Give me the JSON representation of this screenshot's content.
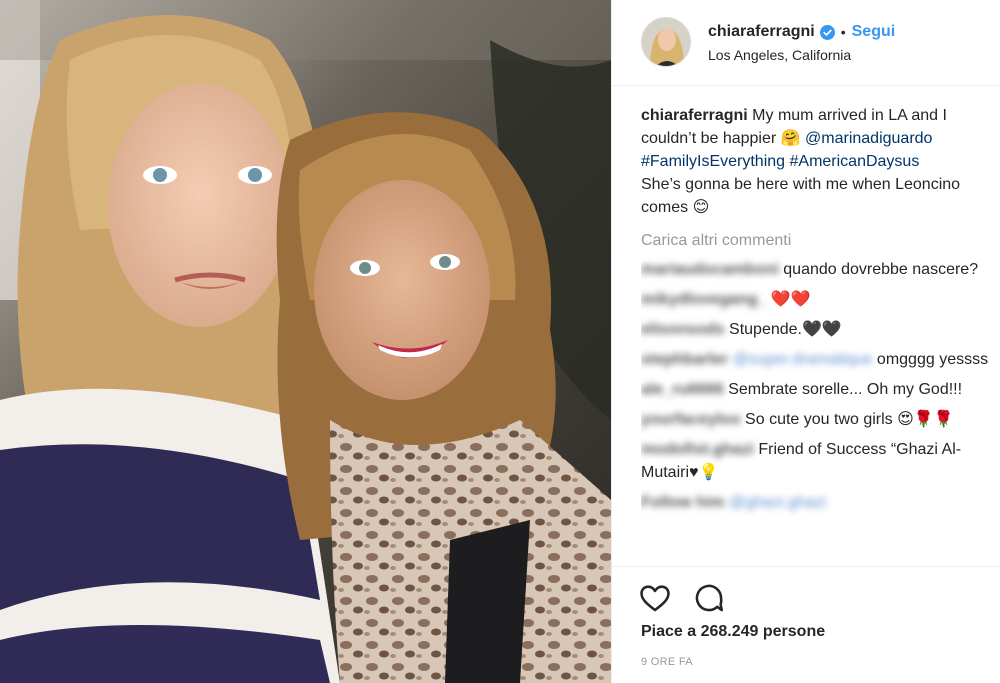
{
  "photo": {
    "alt": ""
  },
  "header": {
    "username": "chiaraferragni",
    "dot": "•",
    "follow_label": "Segui",
    "location": "Los Angeles, California"
  },
  "caption": {
    "username": "chiaraferragni",
    "text_1": "My mum arrived in LA and I couldn’t be happier 🤗",
    "mention": "@marinadiguardo",
    "hashtag_1": "#FamilyIsEverything",
    "hashtag_2": "#AmericanDaysus",
    "text_2": "She’s gonna be here with me when Leoncino comes 😊"
  },
  "load_more_label": "Carica altri commenti",
  "comments": [
    {
      "username": "mariaudocamboni",
      "text": "quando dovrebbe nascere?"
    },
    {
      "username": "mikydlovegang_",
      "text": "❤️❤️"
    },
    {
      "username": "elisonsods",
      "text": "Stupende.🖤🖤"
    },
    {
      "username": "stephbarler",
      "mention": "@super.dramatique",
      "text": "omgggg yessss"
    },
    {
      "username": "ale_ru6666",
      "text": "Sembrate sorelle... Oh my God!!!"
    },
    {
      "username": "yourfaceyloo",
      "text": "So cute you two girls 😍🌹🌹"
    },
    {
      "username": "modofist.ghazi",
      "text": "Friend of Success “Ghazi Al-Mutairi♥💡"
    },
    {
      "username": "Follow him",
      "text": "@ghazi.ghazi"
    }
  ],
  "actions": {
    "like_icon": "heart-outline-icon",
    "comment_icon": "speech-bubble-icon",
    "likes_text": "Piace a 268.249 persone",
    "time_text": "9 ORE FA"
  },
  "colors": {
    "link_blue": "#3897f0",
    "mention_blue": "#003569",
    "muted": "#999999",
    "text": "#262626"
  }
}
